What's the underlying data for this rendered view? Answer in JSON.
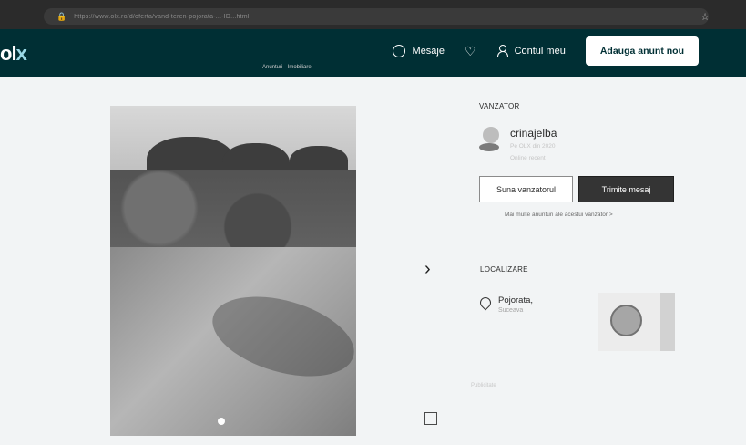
{
  "browser": {
    "url": "https://www.olx.ro/d/oferta/vand-teren-pojorata-...-ID...html",
    "bookmark_icon": "star-icon"
  },
  "header": {
    "logo": "olx",
    "messages_label": "Mesaje",
    "account_label": "Contul meu",
    "post_button_label": "Adauga anunt nou",
    "messages_icon": "chat-bubble-icon",
    "favorites_icon": "heart-icon",
    "account_icon": "user-icon"
  },
  "listing": {
    "breadcrumb": "Anunturi · Imobiliare",
    "next_icon": "chevron-right-icon",
    "fullscreen_icon": "fullscreen-icon"
  },
  "seller": {
    "section_title": "VANZATOR",
    "name": "crinajelba",
    "meta_line_1": "Pe OLX din 2020",
    "meta_line_2": "Online recent",
    "button_call": "Suna vanzatorul",
    "button_message": "Trimite mesaj",
    "more_ads": "Mai multe anunturi ale acestui vanzator >"
  },
  "location": {
    "section_title": "LOCALIZARE",
    "place": "Pojorata,",
    "region": "Suceava"
  },
  "ad_label": "Publicitate"
}
